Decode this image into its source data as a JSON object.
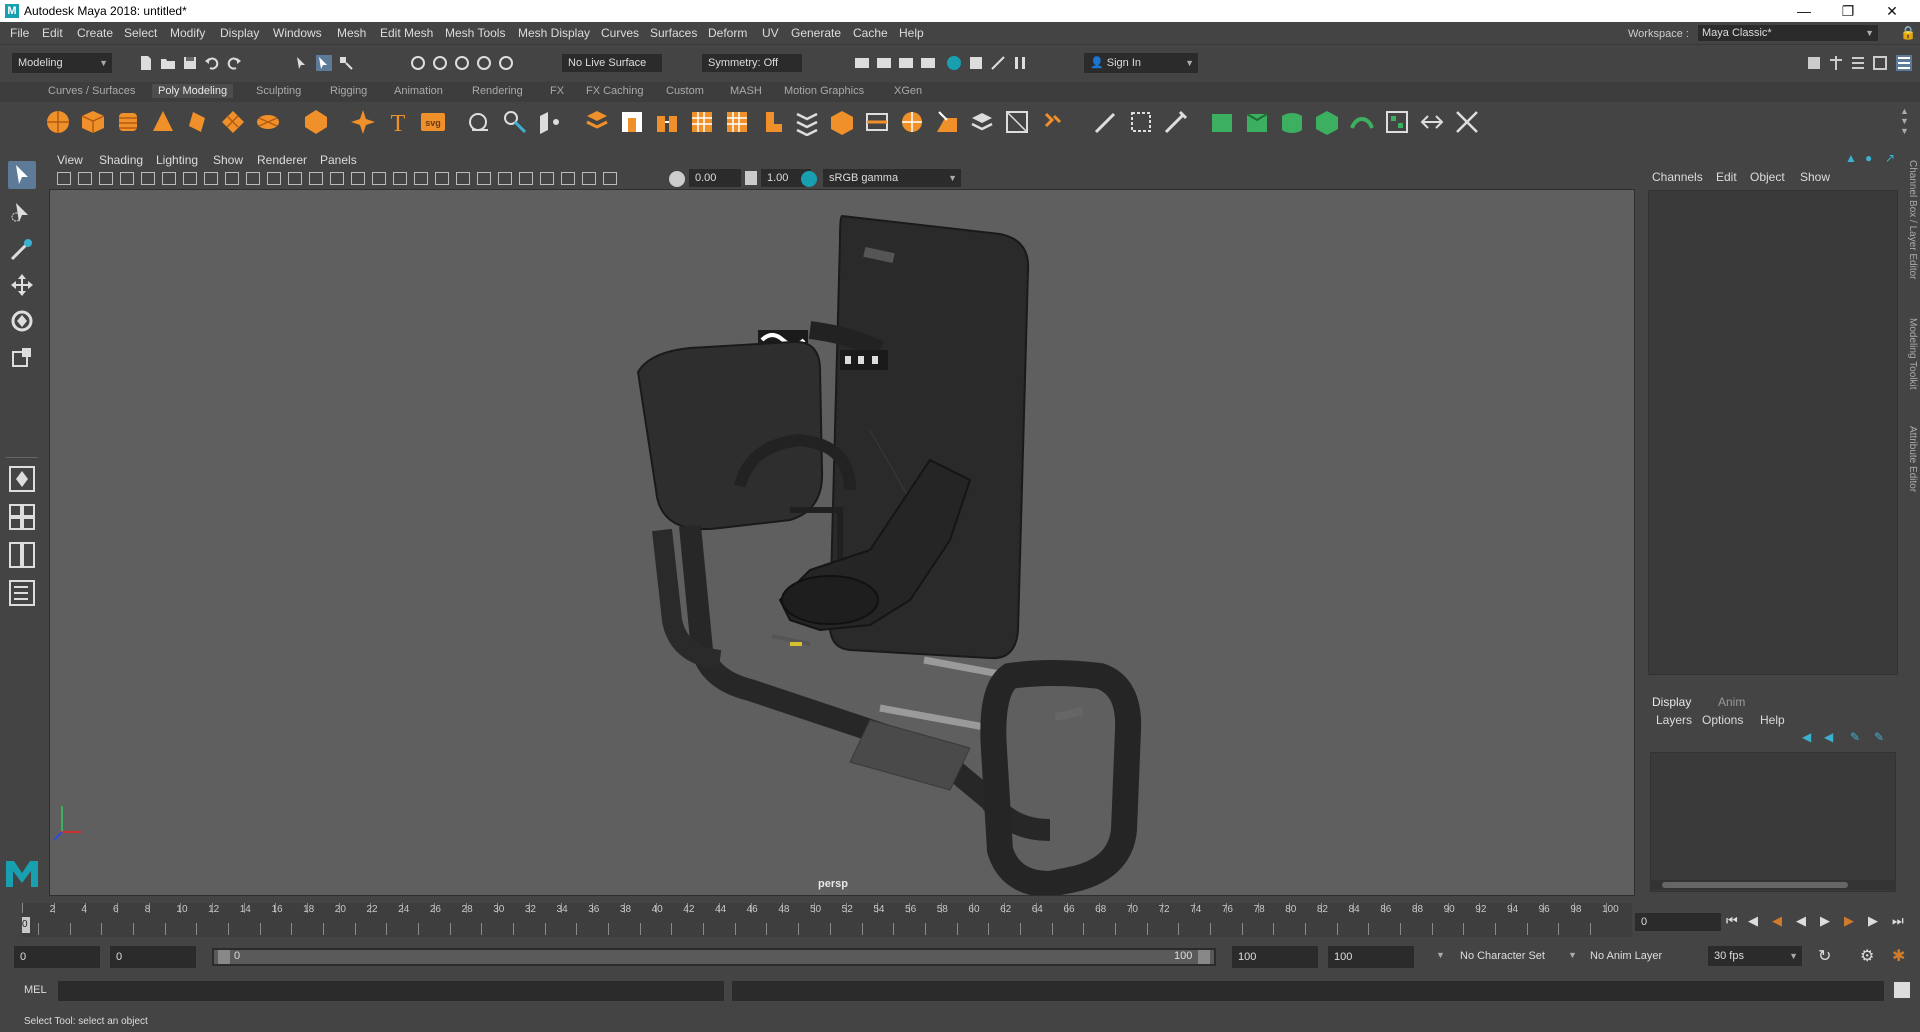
{
  "window": {
    "title": "Autodesk Maya 2018: untitled*",
    "logo": "M",
    "controls": [
      "minimize-icon",
      "restore-icon",
      "close-icon"
    ]
  },
  "menubar": {
    "items": [
      "File",
      "Edit",
      "Create",
      "Select",
      "Modify",
      "Display",
      "Windows",
      "Mesh",
      "Edit Mesh",
      "Mesh Tools",
      "Mesh Display",
      "Curves",
      "Surfaces",
      "Deform",
      "UV",
      "Generate",
      "Cache",
      "Help"
    ],
    "workspace_label": "Workspace :",
    "workspace_value": "Maya Classic*"
  },
  "statusline": {
    "menuset": "Modeling",
    "live_surface": "No Live Surface",
    "symmetry": "Symmetry: Off",
    "sign_in": "Sign In"
  },
  "shelf": {
    "tabs": [
      "Curves / Surfaces",
      "Poly Modeling",
      "Sculpting",
      "Rigging",
      "Animation",
      "Rendering",
      "FX",
      "FX Caching",
      "Custom",
      "MASH",
      "Motion Graphics",
      "XGen"
    ],
    "active_tab": "Poly Modeling",
    "icons": [
      "poly-sphere-icon",
      "poly-cube-icon",
      "poly-cylinder-icon",
      "poly-cone-icon",
      "poly-torus-icon",
      "poly-plane-icon",
      "poly-disc-icon",
      "platonic-solid-icon",
      "super-shape-icon",
      "type-icon",
      "svg-icon",
      "sculpt-icon",
      "soft-select-icon",
      "combine-icon",
      "separate-icon",
      "smooth-icon",
      "extrude-icon",
      "bridge-icon",
      "bevel-icon",
      "fill-hole-icon",
      "append-icon",
      "boolean-icon",
      "mirror-icon",
      "target-weld-icon",
      "multi-cut-icon",
      "insert-edge-loop-icon",
      "offset-edge-icon",
      "bend-icon",
      "uv-icon"
    ],
    "svg_label": "svg",
    "type_label": "T"
  },
  "viewport": {
    "menus": [
      "View",
      "Shading",
      "Lighting",
      "Show",
      "Renderer",
      "Panels"
    ],
    "exposure": "0.00",
    "gamma": "1.00",
    "color_space": "sRGB gamma",
    "camera_label": "persp"
  },
  "channel_box": {
    "menus": [
      "Channels",
      "Edit",
      "Object",
      "Show"
    ],
    "side_tabs": [
      "Channel Box / Layer Editor",
      "Modeling Toolkit",
      "Attribute Editor"
    ]
  },
  "layer_editor": {
    "tabs": [
      "Display",
      "Anim"
    ],
    "active_tab": "Display",
    "menus": [
      "Layers",
      "Options",
      "Help"
    ]
  },
  "timeline": {
    "ticks": [
      "0",
      "2",
      "4",
      "6",
      "8",
      "10",
      "12",
      "14",
      "16",
      "18",
      "20",
      "22",
      "24",
      "26",
      "28",
      "30",
      "32",
      "34",
      "36",
      "38",
      "40",
      "42",
      "44",
      "46",
      "48",
      "50",
      "52",
      "54",
      "56",
      "58",
      "60",
      "62",
      "64",
      "66",
      "68",
      "70",
      "72",
      "74",
      "76",
      "78",
      "80",
      "82",
      "84",
      "86",
      "88",
      "90",
      "92",
      "94",
      "96",
      "98",
      "100"
    ],
    "current_frame": "0",
    "current_frame_marker": "0"
  },
  "range": {
    "start": "0",
    "playback_start": "0",
    "slider_start": "0",
    "slider_end": "100",
    "playback_end": "100",
    "end": "100",
    "character_set": "No Character Set",
    "anim_layer": "No Anim Layer",
    "fps": "30 fps"
  },
  "command": {
    "language": "MEL"
  },
  "help_line": {
    "text": "Select Tool: select an object"
  }
}
